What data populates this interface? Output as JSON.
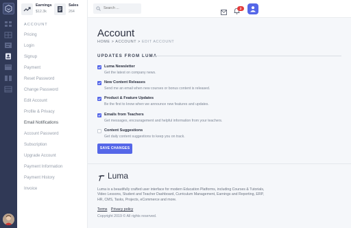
{
  "header": {
    "stats": [
      {
        "label": "Earnings",
        "value": "$12.3k"
      },
      {
        "label": "Sales",
        "value": "264"
      }
    ],
    "search_placeholder": "Search ...",
    "notification_count": "2"
  },
  "sidebar": {
    "heading": "ACCOUNT",
    "items": [
      {
        "label": "Pricing"
      },
      {
        "label": "Login"
      },
      {
        "label": "Signup"
      },
      {
        "label": "Payment"
      },
      {
        "label": "Reset Password"
      },
      {
        "label": "Change Password"
      },
      {
        "label": "Edit Account"
      },
      {
        "label": "Profile & Privacy"
      },
      {
        "label": "Email Notifications"
      },
      {
        "label": "Account Password"
      },
      {
        "label": "Subscription"
      },
      {
        "label": "Upgrade Account"
      },
      {
        "label": "Payment Information"
      },
      {
        "label": "Payment History"
      },
      {
        "label": "Invoice"
      }
    ],
    "active_item": "Email Notifications"
  },
  "page": {
    "title": "Account",
    "breadcrumb": {
      "home": "HOME",
      "sep1": ">",
      "account": "ACCOUNT",
      "sep2": ">",
      "current": "EDIT ACCOUNT"
    },
    "section_title": "UPDATES FROM LUMA",
    "options": [
      {
        "label": "Luma Newsletter",
        "description": "Get the latest on company news.",
        "checked": true
      },
      {
        "label": "New Content Releases",
        "description": "Send me an email when new courses or bonus content is released.",
        "checked": true
      },
      {
        "label": "Product & Feature Updates",
        "description": "Be the first to know when we announce new features and updates.",
        "checked": true
      },
      {
        "label": "Emails from Teachers",
        "description": "Get messages, encouragement and helpful information from your teachers.",
        "checked": true
      },
      {
        "label": "Content Suggestions",
        "description": "Get daily content suggestions to keep you on track.",
        "checked": false
      }
    ],
    "save_label": "SAVE CHANGES"
  },
  "footer": {
    "brand": "Luma",
    "about": "Luma is a beautifully crafted user interface for modern Education Platforms, including Courses & Tutorials, Video Lessons, Student and Teacher Dashboard, Curriculum Management, Earnings and Reporting, ERP, HR, CMS, Tasks, Projects, eCommerce and more.",
    "links": {
      "terms": "Terms",
      "privacy": "Privacy policy"
    },
    "copyright": "Copyright 2019 © All rights reserved."
  },
  "colors": {
    "rail": "#303956",
    "accent": "#5567e8",
    "badge": "#e33b3b"
  }
}
